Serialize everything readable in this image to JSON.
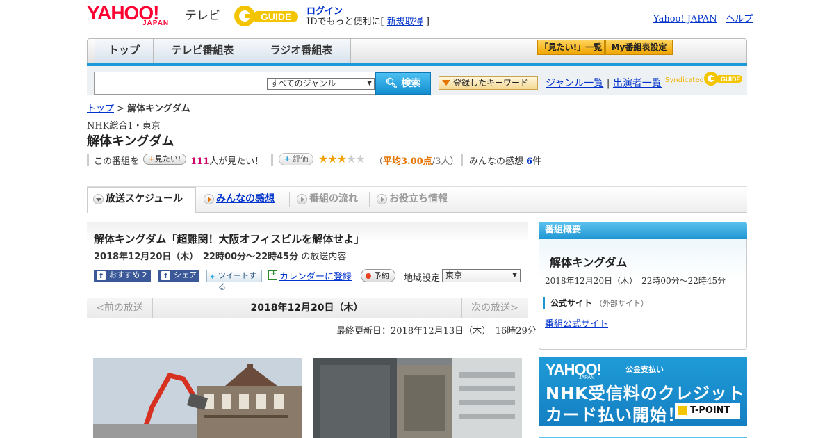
{
  "header": {
    "logo_yahoo": "YAHOO!",
    "logo_japan": "JAPAN",
    "logo_tv": "テレビ",
    "logo_gguide": "G-GUIDE",
    "login_link": "ログイン",
    "login_prefix": "IDでもっと便利に[ ",
    "signup_link": "新規取得",
    "login_suffix": " ]",
    "yahoo_japan_link": "Yahoo! JAPAN",
    "help_sep": " - ",
    "help_link": "ヘルプ"
  },
  "nav": {
    "tabs": [
      "トップ",
      "テレビ番組表",
      "ラジオ番組表"
    ],
    "mitai_list": "「見たい!」一覧",
    "my_schedule": "My番組表設定"
  },
  "search": {
    "genre_selected": "すべてのジャンル",
    "search_button": "検索",
    "keyword_button": "登録したキーワード",
    "genre_list": "ジャンル一覧",
    "separator": "|",
    "performer_list": "出演者一覧",
    "syndicated": "Syndicated"
  },
  "breadcrumb": {
    "top": "トップ",
    "sep": " > ",
    "current": "解体キングダム"
  },
  "program": {
    "channel": "NHK総合1・東京",
    "title": "解体キングダム",
    "this_program": "この番組を",
    "mitai_button": "見たい!",
    "mitai_count": "111",
    "mitai_suffix": "人が見たい！",
    "eval_button": "評価",
    "stars_on": "★★★",
    "stars_off": "★★",
    "rating_open": "（",
    "rating_avg": "平均3.00点",
    "rating_rest": "/3人）",
    "review_label": "みんなの感想",
    "review_count": "6",
    "review_suffix": "件"
  },
  "tabs": [
    {
      "label": "放送スケジュール"
    },
    {
      "label": "みんなの感想"
    },
    {
      "label": "番組の流れ"
    },
    {
      "label": "お役立ち情報"
    }
  ],
  "article": {
    "title": "解体キングダム「超難関！大阪オフィスビルを解体せよ」",
    "date": "2018年12月20日（木）　22時00分～22時45分",
    "date_suffix": "の放送内容",
    "fb_recommend": "おすすめ 2",
    "fb_share": "シェア",
    "tweet": "ツイートする",
    "calendar": "カレンダーに登録",
    "reserve": "予約",
    "region_label": "地域設定",
    "region_value": "東京",
    "prev": "<前の放送",
    "current_date": "2018年12月20日（木）",
    "next": "次の放送>",
    "updated": "最終更新日：2018年12月13日（木）　16時29分"
  },
  "sidebar": {
    "heading": "番組概要",
    "title": "解体キングダム",
    "date": "2018年12月20日（木）　22時00分～22時45分",
    "official_label": "公式サイト",
    "official_sub": "（外部サイト）",
    "official_link": "番組公式サイト"
  },
  "banner": {
    "yahoo": "YAHOO!",
    "japan": "JAPAN",
    "payment": "公金支払い",
    "line1": "NHK受信料のクレジット",
    "line2": "カード払い開始！",
    "tpoint": "T-POINT"
  },
  "colors": {
    "brand_red": "#ff0033",
    "accent_blue": "#1a9ad9",
    "link": "#0033cc",
    "star": "#f0a000"
  }
}
